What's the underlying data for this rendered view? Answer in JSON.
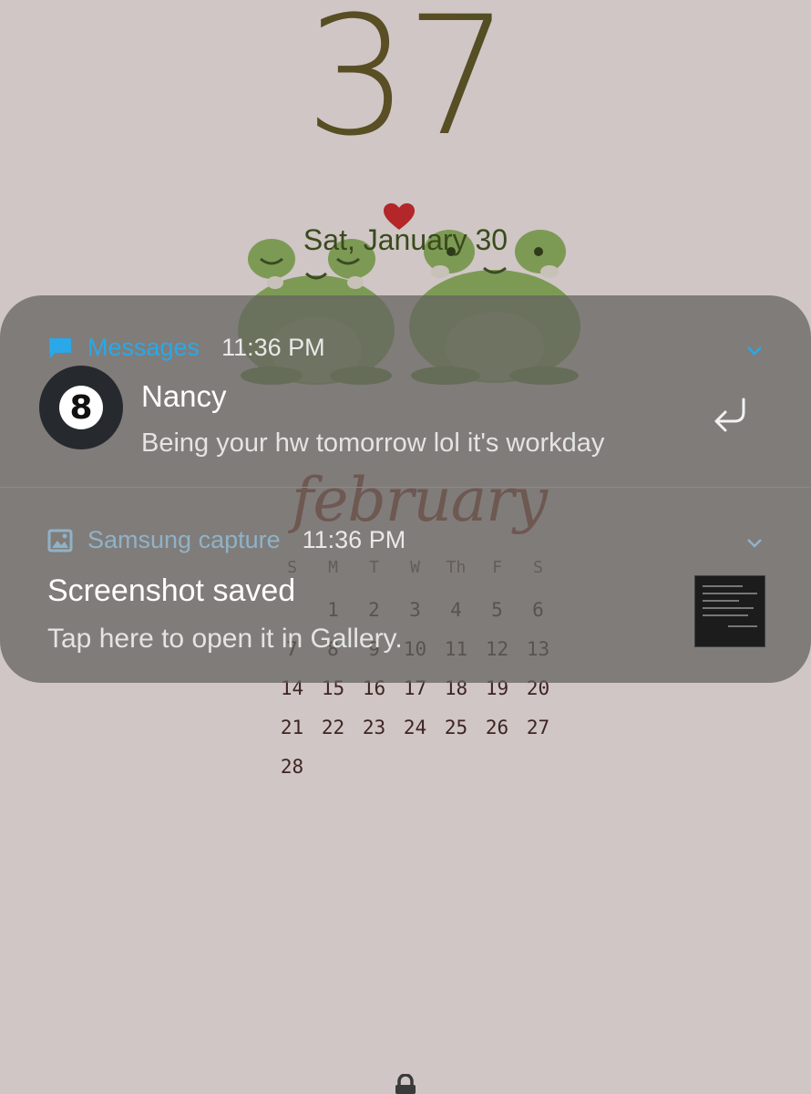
{
  "lockscreen": {
    "clock_minutes": "37",
    "date": "Sat, January 30"
  },
  "wallpaper": {
    "month": "february",
    "weekdays": [
      "S",
      "M",
      "T",
      "W",
      "Th",
      "F",
      "S"
    ],
    "days": [
      "",
      "1",
      "2",
      "3",
      "4",
      "5",
      "6",
      "7",
      "8",
      "9",
      "10",
      "11",
      "12",
      "13",
      "14",
      "15",
      "16",
      "17",
      "18",
      "19",
      "20",
      "21",
      "22",
      "23",
      "24",
      "25",
      "26",
      "27",
      "28"
    ],
    "colors": {
      "frog": "#7d9a55",
      "heart": "#b3262a",
      "month_script": "#8a3b30"
    }
  },
  "notifications": [
    {
      "app": "Messages",
      "app_icon": "message-icon",
      "time": "11:36 PM",
      "sender": "Nancy",
      "text": "Being your hw tomorrow lol it's workday",
      "avatar_icon": "eight-ball-icon",
      "action_icon": "reply-icon",
      "accent": "#2aa8e8"
    },
    {
      "app": "Samsung capture",
      "app_icon": "gallery-icon",
      "time": "11:36 PM",
      "title": "Screenshot saved",
      "text": "Tap here to open it in Gallery.",
      "accent": "#8fb2c8"
    }
  ],
  "bottom": {
    "icon": "lock-icon"
  }
}
